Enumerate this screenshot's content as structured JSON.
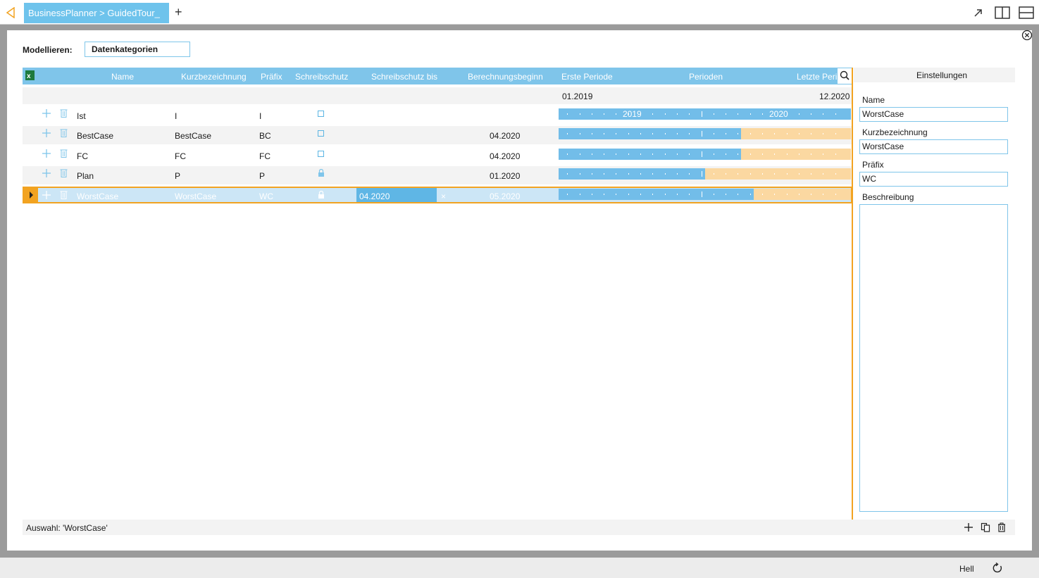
{
  "tab": {
    "title": "BusinessPlanner > GuidedTour_"
  },
  "model": {
    "label": "Modellieren:",
    "value": "Datenkategorien"
  },
  "grid": {
    "columns": [
      "Name",
      "Kurzbezeichnung",
      "Präfix",
      "Schreibschutz",
      "Schreibschutz bis",
      "Berechnungsbeginn",
      "Erste Periode",
      "Perioden",
      "Letzte Peri"
    ],
    "period_start": "01.2019",
    "period_end": "12.2020",
    "years": [
      "2019",
      "2020"
    ],
    "rows": [
      {
        "name": "Ist",
        "kurz": "I",
        "praefix": "I",
        "schutz": "unchecked",
        "schutz_bis": "",
        "beginn": "",
        "fill": 1.0
      },
      {
        "name": "BestCase",
        "kurz": "BestCase",
        "praefix": "BC",
        "schutz": "unchecked",
        "schutz_bis": "",
        "beginn": "04.2020",
        "fill": 0.625
      },
      {
        "name": "FC",
        "kurz": "FC",
        "praefix": "FC",
        "schutz": "unchecked",
        "schutz_bis": "",
        "beginn": "04.2020",
        "fill": 0.625
      },
      {
        "name": "Plan",
        "kurz": "P",
        "praefix": "P",
        "schutz": "locked",
        "schutz_bis": "",
        "beginn": "01.2020",
        "fill": 0.5
      },
      {
        "name": "WorstCase",
        "kurz": "WorstCase",
        "praefix": "WC",
        "schutz": "locked",
        "schutz_bis": "04.2020",
        "beginn": "05.2020",
        "fill": 0.667
      }
    ]
  },
  "status": {
    "selection": "Auswahl: 'WorstCase'"
  },
  "settings": {
    "title": "Einstellungen",
    "name_label": "Name",
    "name_value": "WorstCase",
    "kurz_label": "Kurzbezeichnung",
    "kurz_value": "WorstCase",
    "praefix_label": "Präfix",
    "praefix_value": "WC",
    "beschreibung_label": "Beschreibung",
    "beschreibung_value": ""
  },
  "footer": {
    "theme": "Hell"
  },
  "colors": {
    "accent": "#f2a321",
    "header": "#7fc5ea",
    "timeline_blue": "#72bde9",
    "timeline_orange": "#fbd8a1"
  }
}
